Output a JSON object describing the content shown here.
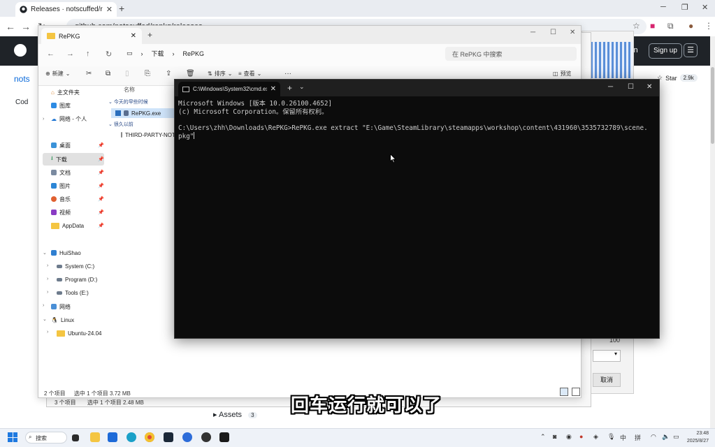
{
  "browser": {
    "tab_title": "Releases · notscuffed/repkg",
    "tab_close": "✕",
    "new_tab": "+",
    "url": "github.com/notscuffed/repkg/releases",
    "window_controls": [
      "─",
      "❐",
      "✕"
    ]
  },
  "github": {
    "sign_in_partial": "in",
    "sign_up": "Sign up",
    "repo_partial": "nots",
    "code_tab": "Cod",
    "star_label": "Star",
    "star_count": "2.9k",
    "assets_label": "Assets",
    "assets_count": "3"
  },
  "dialog": {
    "value": "100",
    "cancel": "取消"
  },
  "explorer": {
    "tab_title": "RePKG",
    "tab_close": "✕",
    "new_tab": "+",
    "window_controls": [
      "─",
      "☐",
      "✕"
    ],
    "breadcrumb": [
      "下载",
      "RePKG"
    ],
    "search_placeholder": "在 RePKG 中搜索",
    "commands": {
      "new": "新建",
      "sort": "排序",
      "view": "查看",
      "more": "···",
      "preview": "预览"
    },
    "sidebar": {
      "home": "主文件夹",
      "gallery": "图库",
      "onedrive": "网络 - 个人",
      "desktop": "桌面",
      "downloads": "下载",
      "documents": "文档",
      "pictures": "图片",
      "music": "音乐",
      "videos": "视频",
      "appdata": "AppData",
      "this_pc": "HuiShao",
      "drive_c": "System (C:)",
      "drive_d": "Program (D:)",
      "drive_e": "Tools (E:)",
      "network": "网络",
      "linux": "Linux",
      "ubuntu": "Ubuntu-24.04"
    },
    "list": {
      "col_name": "名称",
      "group_today": "今天的早些时候",
      "file1": "RePKG.exe",
      "group_last": "很久以前",
      "file2": "THIRD-PARTY-NOTICES.txt"
    },
    "status": {
      "count": "2 个项目",
      "selected": "选中 1 个项目  3.72 MB"
    },
    "back_status": {
      "count": "3 个项目",
      "selected": "选中 1 个项目  2.48 MB"
    }
  },
  "cmd": {
    "tab_title": "C:\\Windows\\System32\\cmd.exe",
    "tab_close": "✕",
    "add": "+",
    "dropdown": "⌄",
    "window_controls": [
      "─",
      "☐",
      "✕"
    ],
    "lines": [
      "Microsoft Windows [版本 10.0.26100.4652]",
      "(c) Microsoft Corporation。保留所有权利。",
      "",
      "C:\\Users\\zhh\\Downloads\\RePKG>RePKG.exe extract \"E:\\Game\\SteamLibrary\\steamapps\\workshop\\content\\431960\\3535732789\\scene.",
      "pkg\""
    ]
  },
  "subtitle": "回车运行就可以了",
  "taskbar": {
    "search": "搜索",
    "tray_lang": "中",
    "tray_ime": "拼",
    "time": "23:48",
    "date": "2025/8/27"
  },
  "colors": {
    "console_bg": "#0c0c0c",
    "console_text": "#cccccc",
    "accent": "#1e79e0",
    "github_header": "#1f2328"
  }
}
